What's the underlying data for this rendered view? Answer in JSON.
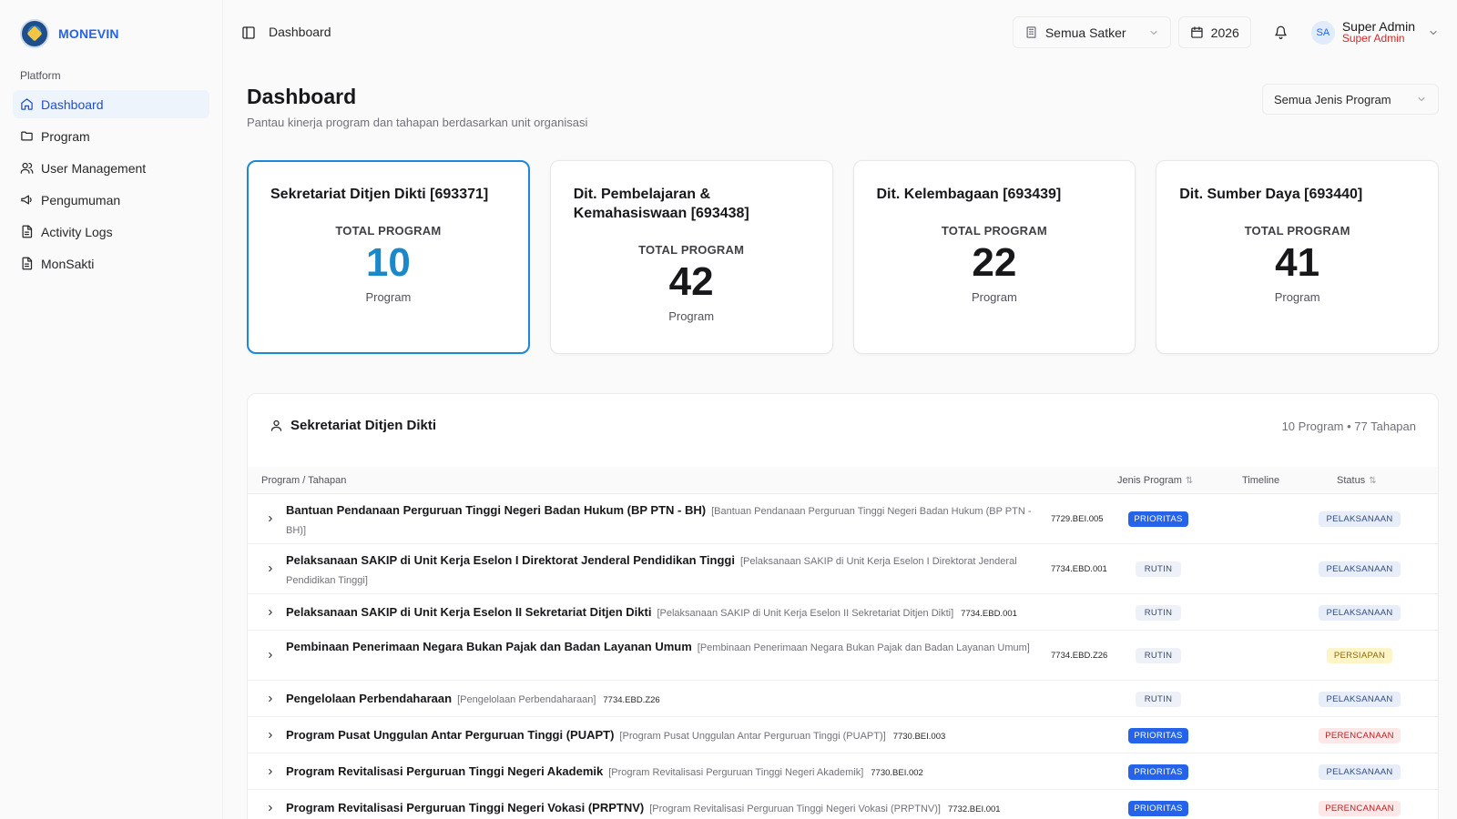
{
  "app": {
    "name": "MONEVIN"
  },
  "sidebar": {
    "section": "Platform",
    "items": [
      {
        "label": "Dashboard",
        "icon": "home-icon",
        "active": true
      },
      {
        "label": "Program",
        "icon": "folder-icon"
      },
      {
        "label": "User Management",
        "icon": "users-icon"
      },
      {
        "label": "Pengumuman",
        "icon": "megaphone-icon"
      },
      {
        "label": "Activity Logs",
        "icon": "file-icon"
      },
      {
        "label": "MonSakti",
        "icon": "file-icon"
      }
    ]
  },
  "topbar": {
    "breadcrumb": "Dashboard",
    "satker": "Semua Satker",
    "year": "2026",
    "user": {
      "initials": "SA",
      "name": "Super Admin",
      "role": "Super Admin"
    }
  },
  "main": {
    "title": "Dashboard",
    "subtitle": "Pantau kinerja program dan tahapan berdasarkan unit organisasi",
    "jenis_filter": "Semua Jenis Program"
  },
  "cards": [
    {
      "title": "Sekretariat Ditjen Dikti [693371]",
      "label": "TOTAL PROGRAM",
      "value": "10",
      "unit": "Program",
      "active": true
    },
    {
      "title": "Dit. Pembelajaran & Kemahasiswaan [693438]",
      "label": "TOTAL PROGRAM",
      "value": "42",
      "unit": "Program"
    },
    {
      "title": "Dit. Kelembagaan [693439]",
      "label": "TOTAL PROGRAM",
      "value": "22",
      "unit": "Program"
    },
    {
      "title": "Dit. Sumber Daya [693440]",
      "label": "TOTAL PROGRAM",
      "value": "41",
      "unit": "Program"
    }
  ],
  "panel": {
    "title": "Sekretariat Ditjen Dikti",
    "meta": "10 Program • 77 Tahapan",
    "columns": {
      "program": "Program / Tahapan",
      "jenis": "Jenis Program",
      "timeline": "Timeline",
      "status": "Status"
    },
    "rows": [
      {
        "name": "Bantuan Pendanaan Perguruan Tinggi Negeri Badan Hukum (BP PTN - BH)",
        "alias": "[Bantuan Pendanaan Perguruan Tinggi Negeri Badan Hukum (BP PTN - BH)]",
        "code": "7729.BEI.005",
        "jenis": "PRIORITAS",
        "status": "PELAKSANAAN"
      },
      {
        "name": "Pelaksanaan SAKIP di Unit Kerja Eselon I Direktorat Jenderal Pendidikan Tinggi",
        "alias": "[Pelaksanaan SAKIP di Unit Kerja Eselon I Direktorat Jenderal Pendidikan Tinggi]",
        "code": "7734.EBD.001",
        "jenis": "RUTIN",
        "status": "PELAKSANAAN"
      },
      {
        "name": "Pelaksanaan SAKIP di Unit Kerja Eselon II Sekretariat Ditjen Dikti",
        "alias": "[Pelaksanaan SAKIP di Unit Kerja Eselon II Sekretariat Ditjen Dikti]",
        "code": "7734.EBD.001",
        "jenis": "RUTIN",
        "status": "PELAKSANAAN"
      },
      {
        "name": "Pembinaan Penerimaan Negara Bukan Pajak dan Badan Layanan Umum",
        "alias": "[Pembinaan Penerimaan Negara Bukan Pajak dan Badan Layanan Umum]",
        "code": "7734.EBD.Z26",
        "jenis": "RUTIN",
        "status": "PERSIAPAN"
      },
      {
        "name": "Pengelolaan Perbendaharaan",
        "alias": "[Pengelolaan Perbendaharaan]",
        "code": "7734.EBD.Z26",
        "jenis": "RUTIN",
        "status": "PELAKSANAAN"
      },
      {
        "name": "Program Pusat Unggulan Antar Perguruan Tinggi (PUAPT)",
        "alias": "[Program Pusat Unggulan Antar Perguruan Tinggi (PUAPT)]",
        "code": "7730.BEI.003",
        "jenis": "PRIORITAS",
        "status": "PERENCANAAN"
      },
      {
        "name": "Program Revitalisasi Perguruan Tinggi Negeri Akademik",
        "alias": "[Program Revitalisasi Perguruan Tinggi Negeri Akademik]",
        "code": "7730.BEI.002",
        "jenis": "PRIORITAS",
        "status": "PELAKSANAAN"
      },
      {
        "name": "Program Revitalisasi Perguruan Tinggi Negeri Vokasi (PRPTNV)",
        "alias": "[Program Revitalisasi Perguruan Tinggi Negeri Vokasi (PRPTNV)]",
        "code": "7732.BEI.001",
        "jenis": "PRIORITAS",
        "status": "PERENCANAAN"
      }
    ]
  },
  "colors": {
    "accent": "#2563eb",
    "active_card": "#1e88d8",
    "danger": "#dc2626"
  }
}
